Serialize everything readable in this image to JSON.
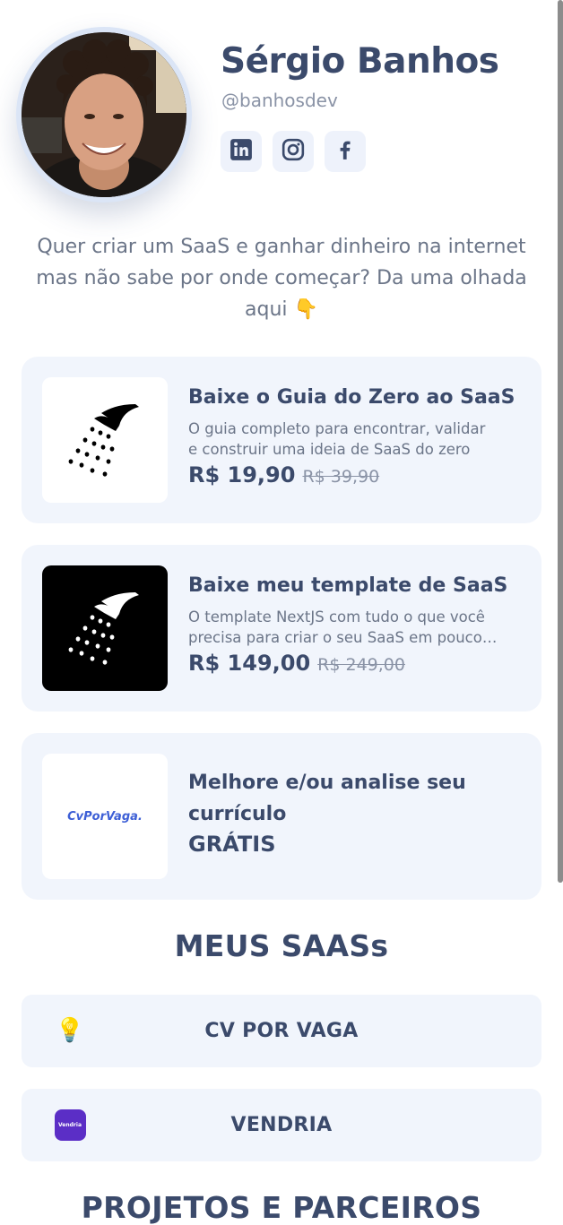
{
  "profile": {
    "name": "Sérgio Banhos",
    "handle": "@banhosdev",
    "bio": "Quer criar um SaaS e ganhar dinheiro na internet mas não sabe por onde começar? Da uma olhada aqui 👇"
  },
  "social": [
    {
      "name": "linkedin",
      "icon": "linkedin-icon"
    },
    {
      "name": "instagram",
      "icon": "instagram-icon"
    },
    {
      "name": "facebook",
      "icon": "facebook-icon"
    }
  ],
  "products": [
    {
      "title": "Baixe o Guia do Zero ao SaaS",
      "description": "O guia completo para encontrar, validar e construir uma ideia de SaaS do zero",
      "price": "R$ 19,90",
      "old_price": "R$ 39,90",
      "icon": "shower-icon"
    },
    {
      "title": "Baixe meu template de SaaS",
      "description": "O template NextJS com tudo o que você precisa para criar o seu SaaS em poucos dias",
      "price": "R$ 149,00",
      "old_price": "R$ 249,00",
      "icon": "shower-icon"
    },
    {
      "title": "Melhore e/ou analise seu currículo",
      "price_label": "GRÁTIS",
      "logo_text": "CvPorVaga."
    }
  ],
  "saas_section": {
    "title": "MEUS SAASs",
    "items": [
      {
        "label": "CV POR VAGA",
        "icon": "💡"
      },
      {
        "label": "VENDRIA",
        "logo_text": "Vendria"
      }
    ]
  },
  "partners_section": {
    "title": "PROJETOS E PARCEIROS"
  },
  "colors": {
    "text_primary": "#3b4a6b",
    "text_muted": "#6b7588",
    "card_bg": "#f1f5fc",
    "vendria": "#5b2ec6",
    "cv_logo": "#3d5fd6"
  }
}
